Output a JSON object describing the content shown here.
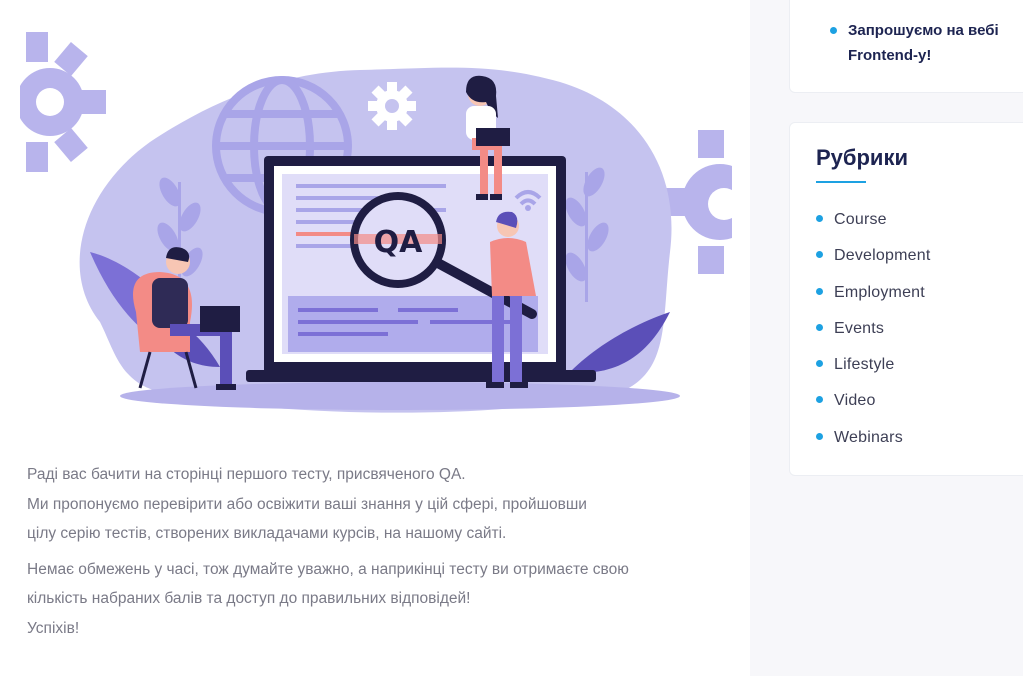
{
  "article": {
    "illustration": {
      "badge": "QA",
      "colors": {
        "blob": "#c5c3ef",
        "accent": "#a9a5e8",
        "dark": "#1f1d43",
        "coral": "#f38b86",
        "purple": "#7c70d6"
      }
    },
    "paragraph1": [
      "Раді вас бачити на сторінці першого тесту, присвяченого QA.",
      "Ми пропонуємо перевірити або освіжити ваші знання у цій сфері, пройшовши",
      "цілу серію тестів, створених викладачами курсів, на нашому сайті."
    ],
    "paragraph2": [
      "Немає обмежень у часі, тож думайте уважно, а наприкінці тесту ви отримаєте свою",
      "кількість набраних балів та доступ до правильних відповідей!",
      "Успіхів!"
    ]
  },
  "sidebar": {
    "news": {
      "item": [
        "Запрошуємо на вебі",
        "Frontend-у!"
      ]
    },
    "rubrics": {
      "title": "Рубрики",
      "items": [
        "Course",
        "Development",
        "Employment",
        "Events",
        "Lifestyle",
        "Video",
        "Webinars"
      ]
    },
    "colors": {
      "title": "#1d2451",
      "bullet": "#1da1e2"
    }
  }
}
